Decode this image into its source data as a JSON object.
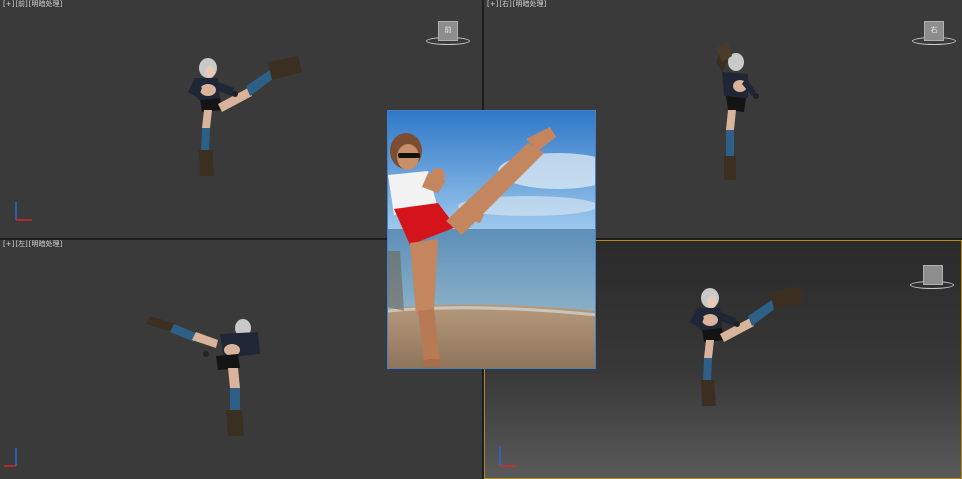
{
  "viewports": {
    "front": {
      "label_parts": [
        "[+]",
        "[前]",
        "[明暗处理]"
      ],
      "cube_label": "前"
    },
    "right": {
      "label_parts": [
        "[+]",
        "[右]",
        "[明暗处理]"
      ],
      "cube_label": "右"
    },
    "left": {
      "label_parts": [
        "[+]",
        "[左]",
        "[明暗处理]"
      ],
      "cube_label": "左"
    },
    "perspective": {
      "label_parts": [
        "",
        "",
        ""
      ],
      "cube_label": ""
    }
  },
  "colors": {
    "viewport_bg": "#3a3a3a",
    "active_border": "#b28a1c",
    "reference_border": "#4a7fc4",
    "axis_x": "#d02a2a",
    "axis_y": "#2a6ad0"
  },
  "icons": [
    "viewcube-icon",
    "axis-gizmo-icon"
  ]
}
